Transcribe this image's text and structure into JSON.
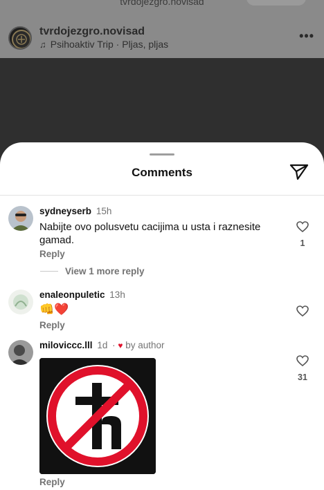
{
  "background": {
    "url_text": "tvrdojezgro.novisad",
    "post": {
      "username": "tvrdojezgro.novisad",
      "music": "Psihoaktiv Trip · Pljas, pljas",
      "more_icon": "more-dots-icon"
    }
  },
  "sheet": {
    "title": "Comments",
    "share_icon": "send-icon"
  },
  "comments": [
    {
      "username": "sydneyserb",
      "time": "15h",
      "text": "Nabijte ovo polusvetu cacijima u usta i raznesite gamad.",
      "reply_label": "Reply",
      "view_more": "View 1 more reply",
      "likes": "1"
    },
    {
      "username": "enaleonpuletic",
      "time": "13h",
      "emojis": "👊❤️",
      "reply_label": "Reply",
      "likes": ""
    },
    {
      "username": "miloviccc.lll",
      "time": "1d",
      "liked_by": "by author",
      "reply_label": "Reply",
      "likes": "31",
      "sticker": "no-cross-h-sticker"
    }
  ],
  "colors": {
    "heart_red": "#e0112b",
    "muted_text": "#737373",
    "dim_overlay": "#7c7c7c"
  }
}
